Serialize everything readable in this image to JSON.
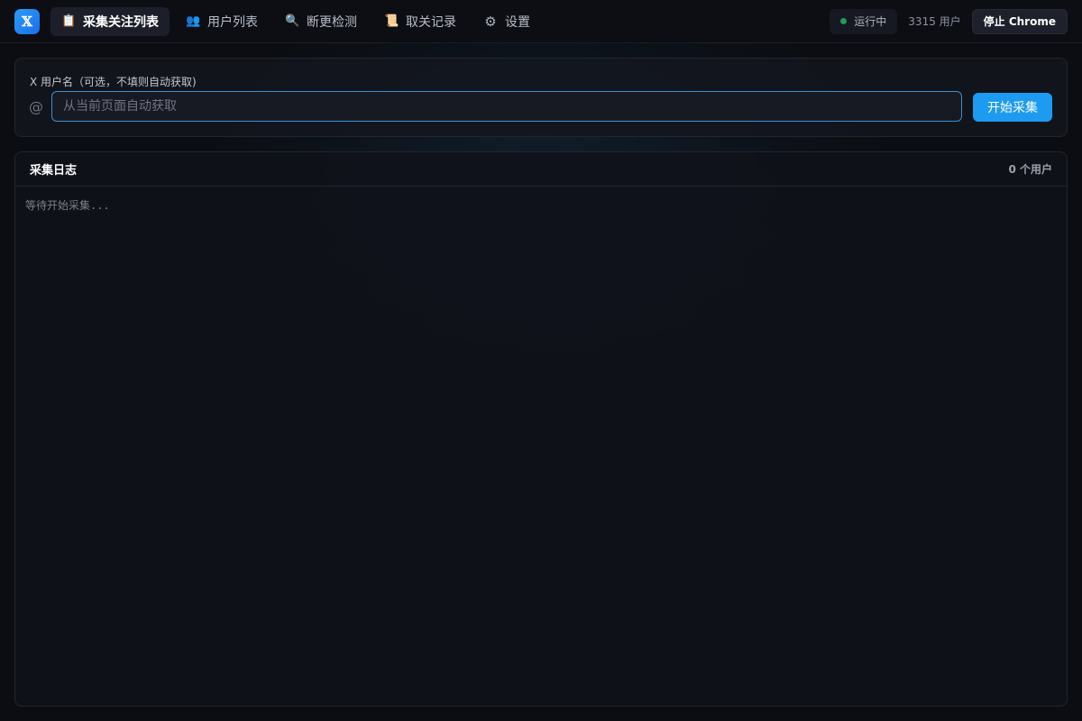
{
  "app": {
    "logo_glyph": "𝕏",
    "accent_color": "#1d9bf0"
  },
  "nav": {
    "tabs": [
      {
        "label": "采集关注列表",
        "icon": "clipboard-icon",
        "glyph": "📋",
        "active": true
      },
      {
        "label": "用户列表",
        "icon": "users-icon",
        "glyph": "👥",
        "active": false
      },
      {
        "label": "断更检测",
        "icon": "search-icon",
        "glyph": "🔍",
        "active": false
      },
      {
        "label": "取关记录",
        "icon": "scroll-icon",
        "glyph": "📜",
        "active": false
      },
      {
        "label": "设置",
        "icon": "gear-icon",
        "glyph": "⚙",
        "active": false
      }
    ]
  },
  "header": {
    "status_label": "运行中",
    "status_color": "#1f9d55",
    "user_count": "3315 用户",
    "stop_label": "停止 Chrome"
  },
  "collect": {
    "field_label": "X 用户名（可选，不填则自动获取)",
    "at_sign": "@",
    "input_value": "",
    "input_placeholder": "从当前页面自动获取",
    "start_label": "开始采集"
  },
  "log": {
    "title": "采集日志",
    "count": "0 个用户",
    "message": "等待开始采集..."
  }
}
